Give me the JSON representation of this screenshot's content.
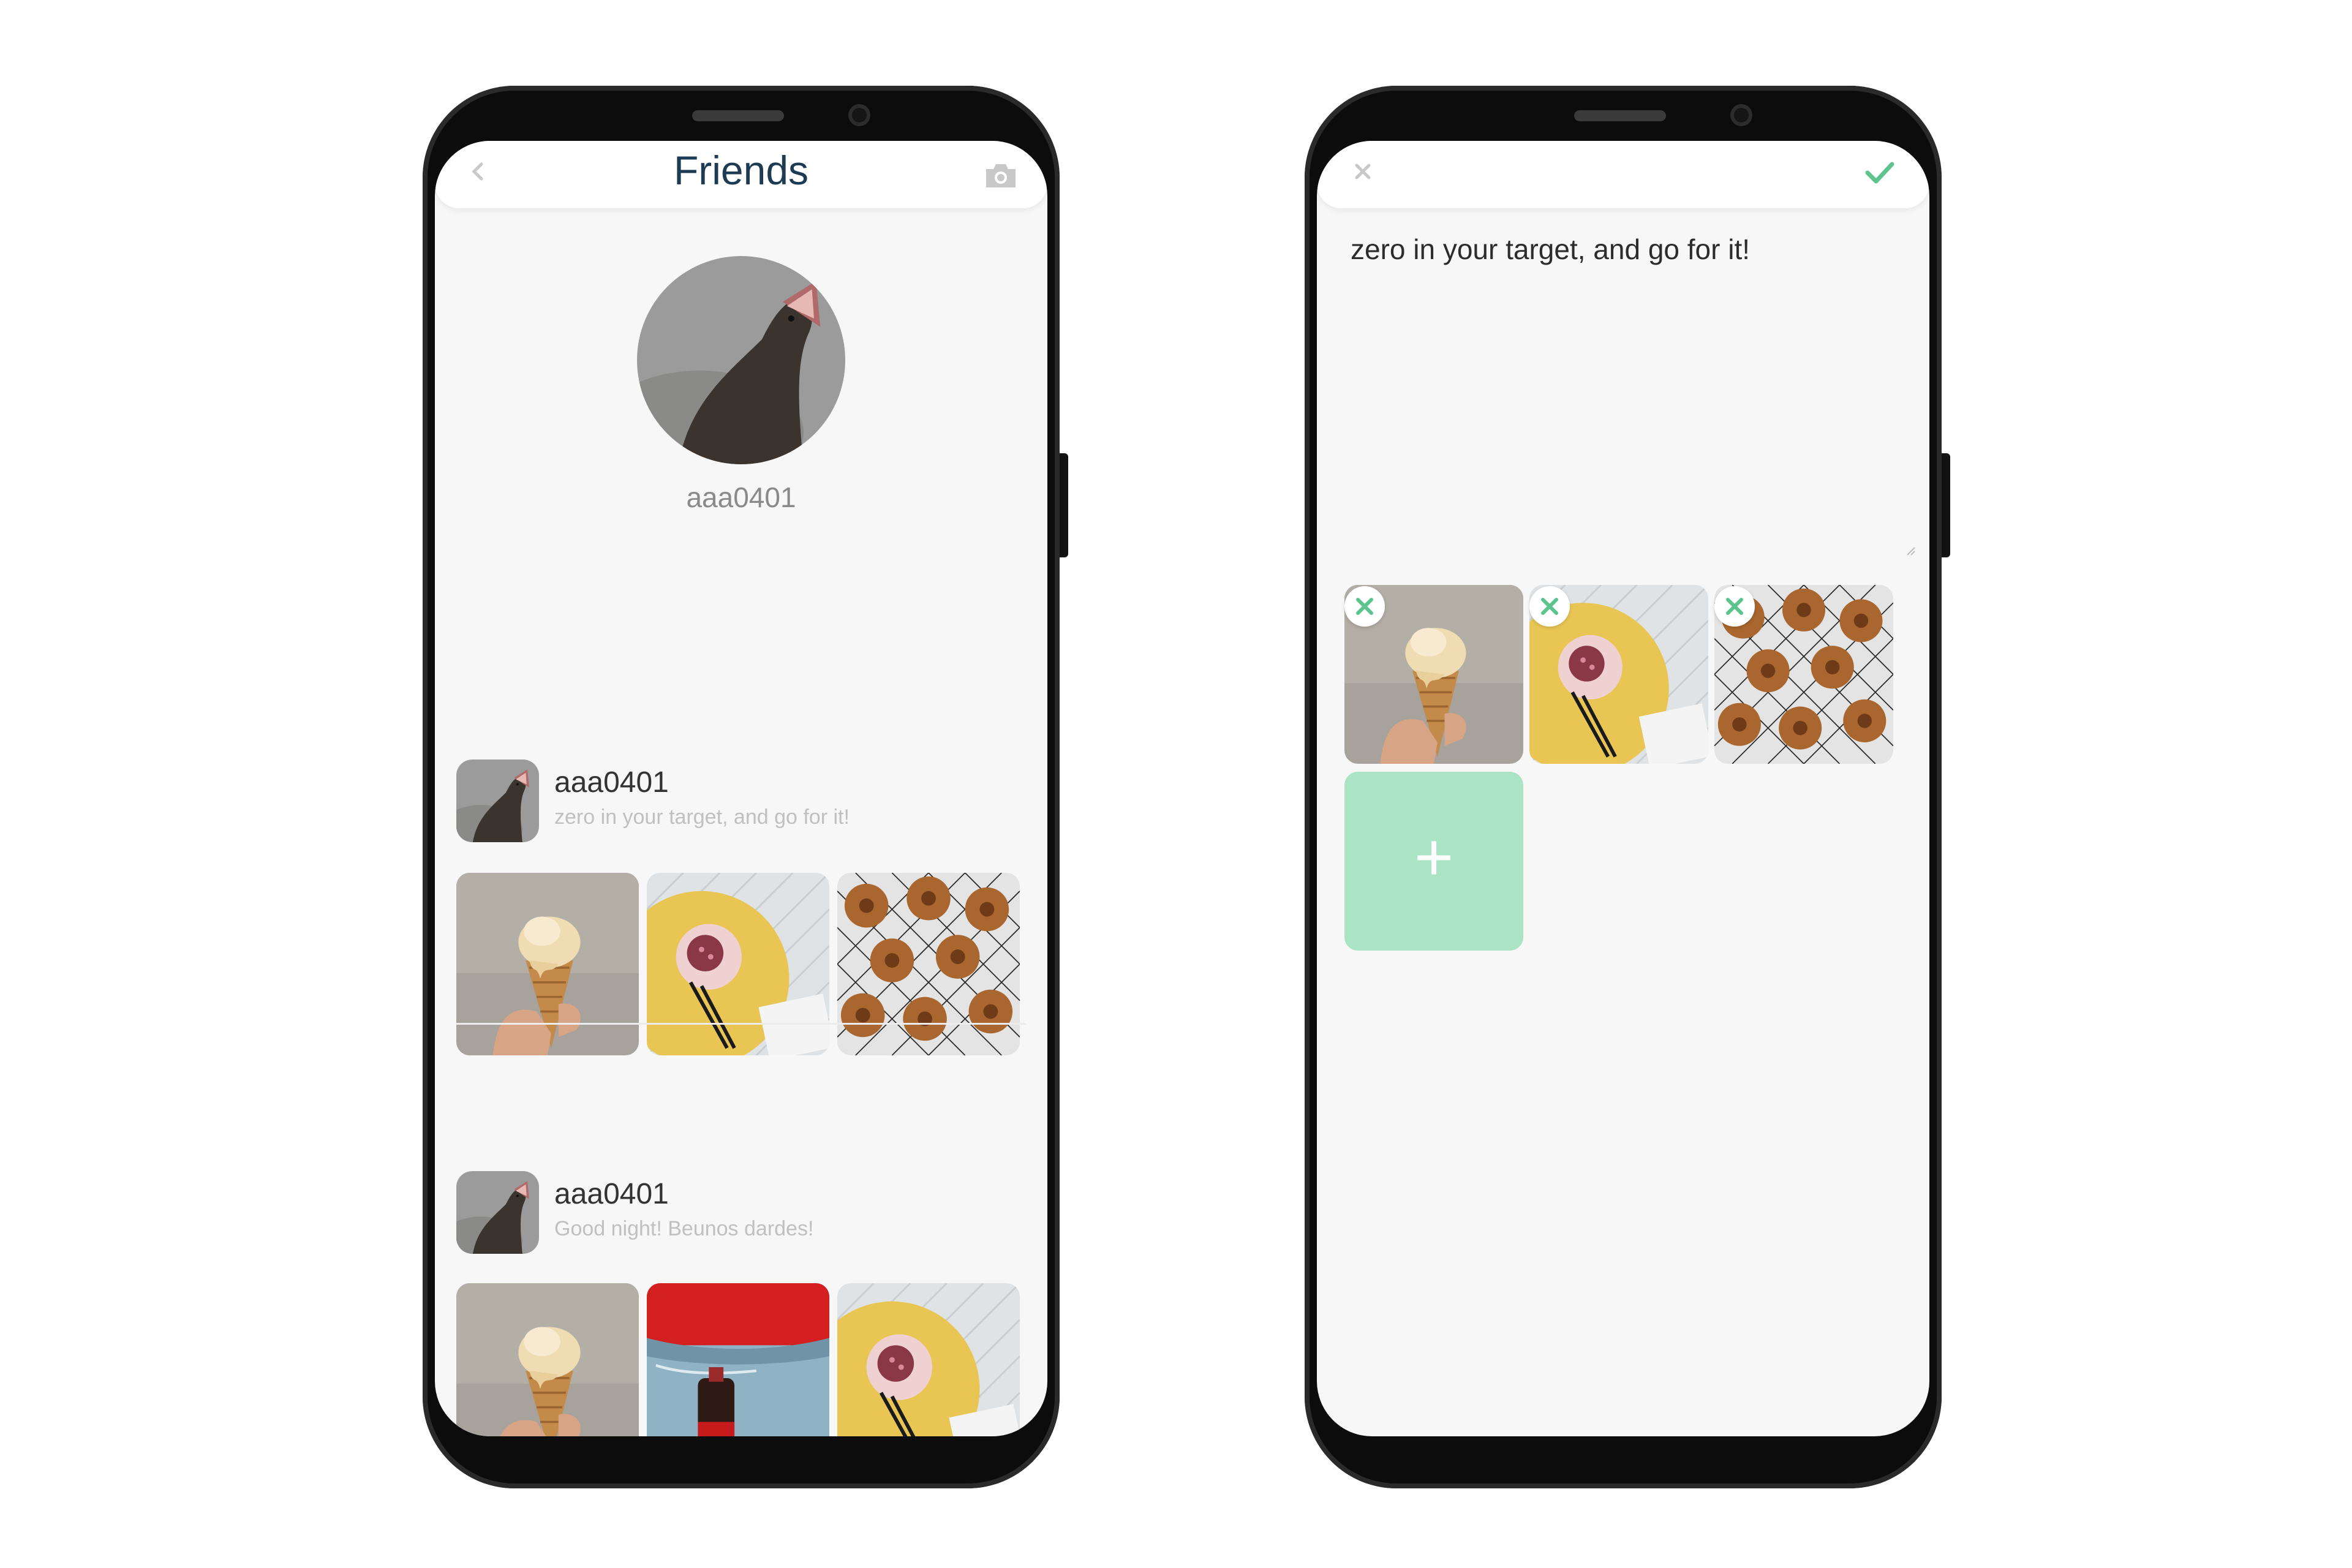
{
  "left_screen": {
    "header": {
      "title": "Friends",
      "back_icon": "chevron-left-icon",
      "camera_icon": "camera-icon"
    },
    "profile": {
      "username": "aaa0401",
      "avatar": "sea-lion-photo"
    },
    "posts": [
      {
        "username": "aaa0401",
        "text": "zero in your target, and go for it!",
        "photos": [
          "ice-cream-cone-photo",
          "donut-plate-photo",
          "donuts-on-rack-photo"
        ]
      },
      {
        "username": "aaa0401",
        "text": "Good night! Beunos dardes!",
        "photos": [
          "ice-cream-cone-photo",
          "jeans-coca-cola-photo",
          "donut-plate-photo"
        ]
      }
    ]
  },
  "right_screen": {
    "header": {
      "close_icon": "close-icon",
      "confirm_icon": "check-icon"
    },
    "post_text": "zero in your target, and go for it!",
    "attachments": [
      "ice-cream-cone-photo",
      "donut-plate-photo",
      "donuts-on-rack-photo"
    ],
    "add_button_label": "+"
  },
  "colors": {
    "accent": "#5ec48e",
    "add_tile": "#abe3c5",
    "title": "#1d3b52",
    "screen_bg": "#f7f7f7"
  }
}
